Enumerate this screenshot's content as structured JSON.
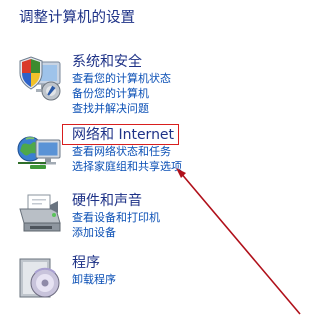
{
  "page": {
    "title": "调整计算机的设置"
  },
  "categories": [
    {
      "title": "系统和安全",
      "icon": "shield-computer-icon",
      "links": [
        "查看您的计算机状态",
        "备份您的计算机",
        "查找并解决问题"
      ]
    },
    {
      "title": "网络和 Internet",
      "icon": "network-globe-icon",
      "links": [
        "查看网络状态和任务",
        "选择家庭组和共享选项"
      ]
    },
    {
      "title": "硬件和声音",
      "icon": "printer-icon",
      "links": [
        "查看设备和打印机",
        "添加设备"
      ]
    },
    {
      "title": "程序",
      "icon": "programs-disc-icon",
      "links": [
        "卸载程序"
      ]
    }
  ],
  "annotation": {
    "highlight_color": "#d81e1e",
    "arrow_color": "#b0101a"
  },
  "colors": {
    "heading": "#1e3287",
    "link": "#0a4fb5"
  }
}
